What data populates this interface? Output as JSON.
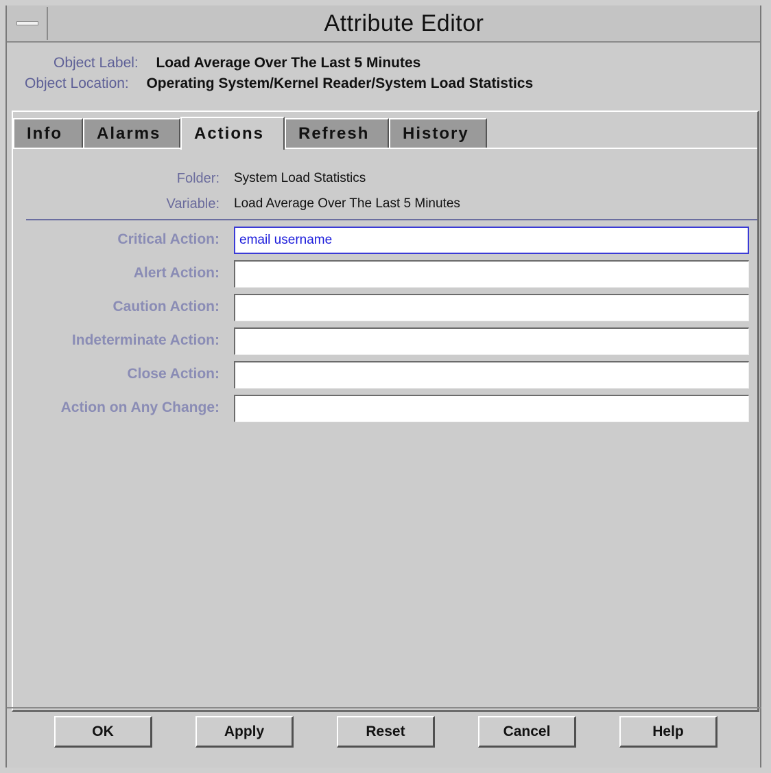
{
  "window": {
    "title": "Attribute Editor"
  },
  "object": {
    "label_caption": "Object Label:",
    "label_value": "Load Average Over The Last 5 Minutes",
    "location_caption": "Object Location:",
    "location_value": "Operating System/Kernel Reader/System Load Statistics"
  },
  "tabs": [
    {
      "label": "Info",
      "active": false
    },
    {
      "label": "Alarms",
      "active": false
    },
    {
      "label": "Actions",
      "active": true
    },
    {
      "label": "Refresh",
      "active": false
    },
    {
      "label": "History",
      "active": false
    }
  ],
  "actions_tab": {
    "folder_label": "Folder:",
    "folder_value": "System Load Statistics",
    "variable_label": "Variable:",
    "variable_value": "Load Average Over The Last 5 Minutes",
    "fields": [
      {
        "label": "Critical Action:",
        "value": "email username"
      },
      {
        "label": "Alert Action:",
        "value": ""
      },
      {
        "label": "Caution Action:",
        "value": ""
      },
      {
        "label": "Indeterminate Action:",
        "value": ""
      },
      {
        "label": "Close Action:",
        "value": ""
      },
      {
        "label": "Action on Any Change:",
        "value": ""
      }
    ]
  },
  "buttons": {
    "ok": "OK",
    "apply": "Apply",
    "reset": "Reset",
    "cancel": "Cancel",
    "help": "Help"
  },
  "icons": {
    "window_menu": "window-menu-icon"
  },
  "colors": {
    "label_blue": "#5d5f96",
    "focus_border": "#3a3ad6",
    "input_text": "#1a1adb",
    "tab_inactive": "#9a9a9a",
    "background": "#cccccc"
  }
}
